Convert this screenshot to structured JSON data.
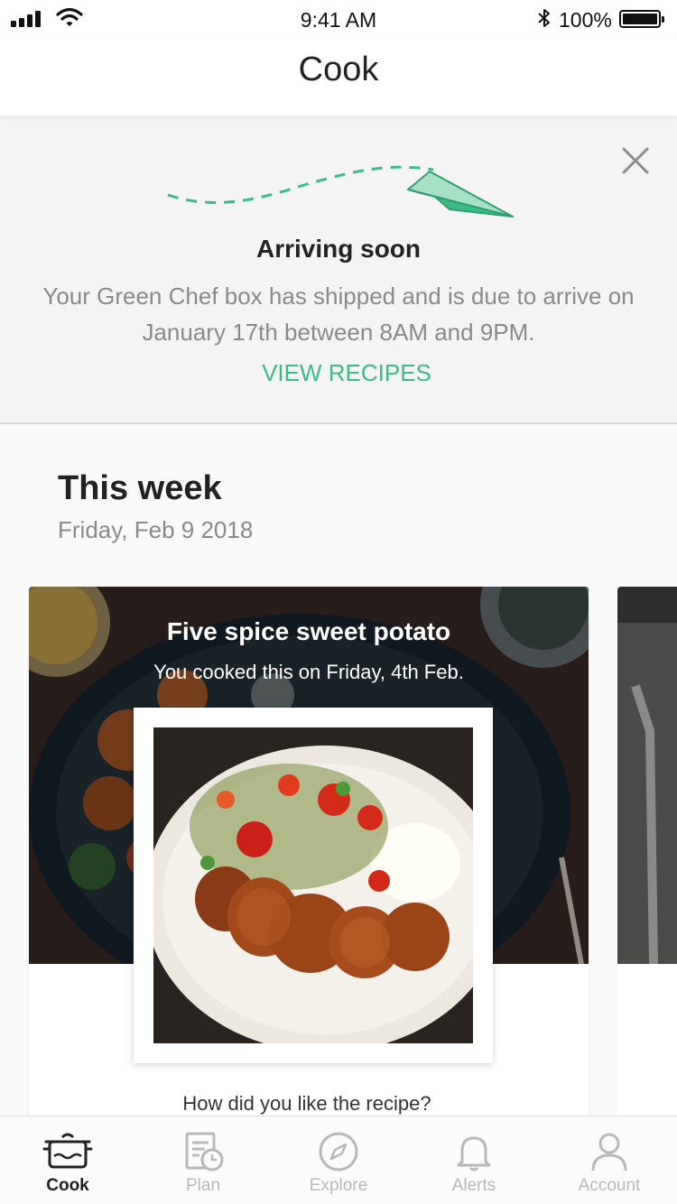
{
  "status_bar": {
    "time": "9:41 AM",
    "battery": "100%"
  },
  "nav": {
    "title": "Cook"
  },
  "banner": {
    "title": "Arriving soon",
    "message": "Your Green Chef box has shipped and is due to arrive on January 17th between 8AM and 9PM.",
    "link": "VIEW RECIPES",
    "accent_color": "#3dbb87"
  },
  "week": {
    "title": "This week",
    "date": "Friday, Feb 9 2018"
  },
  "recipe_card": {
    "title": "Five spice sweet potato",
    "subtitle": "You cooked this on Friday, 4th Feb.",
    "question": "How did you like the recipe?"
  },
  "tabs": [
    {
      "label": "Cook",
      "icon": "pot-icon",
      "active": true
    },
    {
      "label": "Plan",
      "icon": "calendar-clock-icon",
      "active": false
    },
    {
      "label": "Explore",
      "icon": "compass-icon",
      "active": false
    },
    {
      "label": "Alerts",
      "icon": "bell-icon",
      "active": false
    },
    {
      "label": "Account",
      "icon": "person-icon",
      "active": false
    }
  ]
}
